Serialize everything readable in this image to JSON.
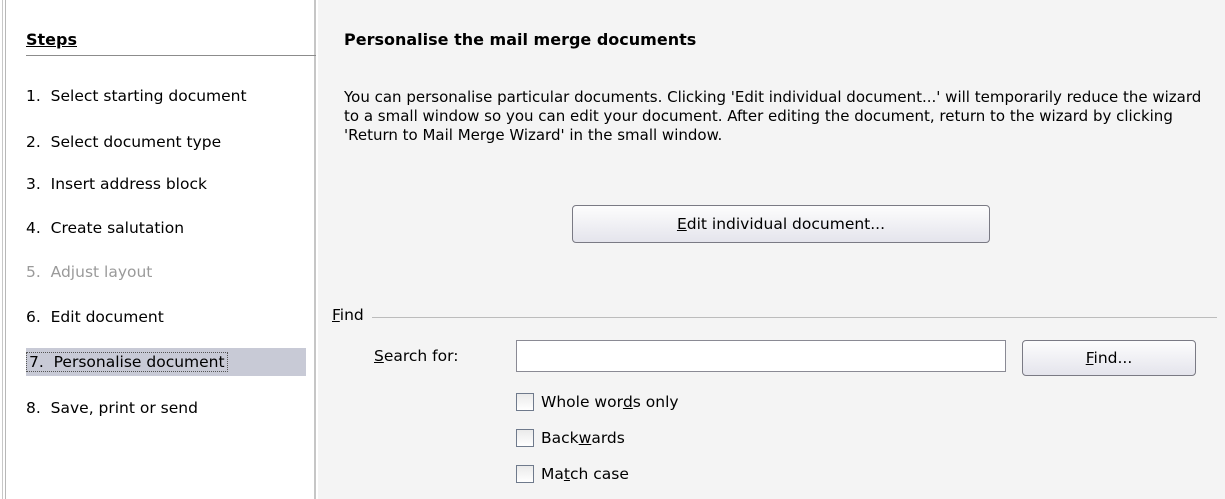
{
  "sidebar": {
    "title": "Steps",
    "steps": [
      {
        "label": "1.  Select starting document",
        "state": "normal"
      },
      {
        "label": "2.  Select document type",
        "state": "normal"
      },
      {
        "label": "3.  Insert address block",
        "state": "normal"
      },
      {
        "label": "4.  Create salutation",
        "state": "normal"
      },
      {
        "label": "5.  Adjust layout",
        "state": "disabled"
      },
      {
        "label": "6.  Edit document",
        "state": "normal"
      },
      {
        "label": "7.  Personalise document",
        "state": "active"
      },
      {
        "label": "8.  Save, print or send",
        "state": "normal"
      }
    ]
  },
  "main": {
    "title": "Personalise the mail merge documents",
    "description": "You can personalise particular documents. Clicking 'Edit individual document...' will temporarily reduce the wizard to a small window so you can edit your document. After editing the document, return to the wizard by clicking 'Return to Mail Merge Wizard' in the small window.",
    "edit_button": {
      "mnemonic": "E",
      "rest": "dit individual document..."
    },
    "find": {
      "group_label": {
        "mnemonic": "F",
        "rest": "ind"
      },
      "search_label": {
        "mnemonic": "S",
        "rest": "earch for:"
      },
      "search_value": "",
      "find_button": {
        "mnemonic": "F",
        "rest": "ind..."
      },
      "options": [
        {
          "before": "Whole wor",
          "mnemonic": "d",
          "after": "s only",
          "checked": false
        },
        {
          "before": "Back",
          "mnemonic": "w",
          "after": "ards",
          "checked": false
        },
        {
          "before": "Ma",
          "mnemonic": "t",
          "after": "ch case",
          "checked": false
        }
      ]
    }
  },
  "colors": {
    "active_step_bg": "#c8cad6",
    "disabled_text": "#9a9a9a",
    "panel_bg": "#f4f4f4"
  }
}
